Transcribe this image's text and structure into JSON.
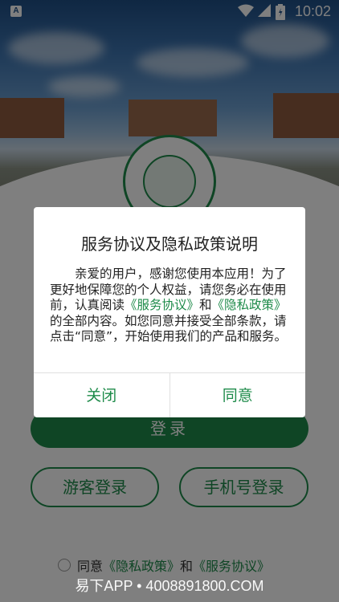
{
  "status_bar": {
    "time": "10:02",
    "app_badge": "A"
  },
  "dialog": {
    "title": "服务协议及隐私政策说明",
    "body_part1": "亲爱的用户，感谢您使用本应用！为了更好地保障您的个人权益，请您务必在使用前，认真阅读",
    "link_service": "《服务协议》",
    "and": "和",
    "link_privacy": "《隐私政策》",
    "body_part2": "的全部内容。如您同意并接受全部条款，请点击“同意”，开始使用我们的产品和服务。",
    "close_label": "关闭",
    "agree_label": "同意"
  },
  "login": {
    "login_label": "登录",
    "guest_label": "游客登录",
    "phone_label": "手机号登录"
  },
  "agreement": {
    "prefix": "同意",
    "privacy_link": "《隐私政策》",
    "and": "和",
    "service_link": "《服务协议》"
  },
  "watermark": "易下APP • 4008891800.COM",
  "colors": {
    "accent": "#1e8b4a",
    "overlay": "rgba(0,0,0,0.5)"
  }
}
